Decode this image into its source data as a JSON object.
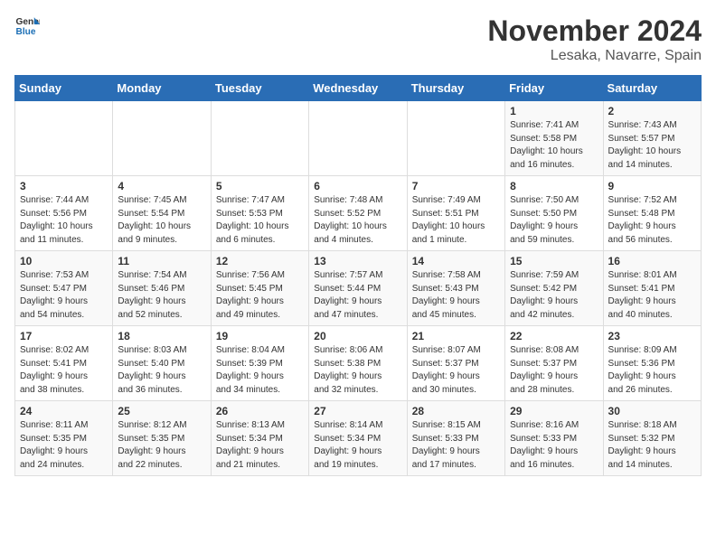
{
  "header": {
    "logo_line1": "General",
    "logo_line2": "Blue",
    "month_title": "November 2024",
    "location": "Lesaka, Navarre, Spain"
  },
  "weekdays": [
    "Sunday",
    "Monday",
    "Tuesday",
    "Wednesday",
    "Thursday",
    "Friday",
    "Saturday"
  ],
  "weeks": [
    [
      {
        "day": "",
        "info": ""
      },
      {
        "day": "",
        "info": ""
      },
      {
        "day": "",
        "info": ""
      },
      {
        "day": "",
        "info": ""
      },
      {
        "day": "",
        "info": ""
      },
      {
        "day": "1",
        "info": "Sunrise: 7:41 AM\nSunset: 5:58 PM\nDaylight: 10 hours\nand 16 minutes."
      },
      {
        "day": "2",
        "info": "Sunrise: 7:43 AM\nSunset: 5:57 PM\nDaylight: 10 hours\nand 14 minutes."
      }
    ],
    [
      {
        "day": "3",
        "info": "Sunrise: 7:44 AM\nSunset: 5:56 PM\nDaylight: 10 hours\nand 11 minutes."
      },
      {
        "day": "4",
        "info": "Sunrise: 7:45 AM\nSunset: 5:54 PM\nDaylight: 10 hours\nand 9 minutes."
      },
      {
        "day": "5",
        "info": "Sunrise: 7:47 AM\nSunset: 5:53 PM\nDaylight: 10 hours\nand 6 minutes."
      },
      {
        "day": "6",
        "info": "Sunrise: 7:48 AM\nSunset: 5:52 PM\nDaylight: 10 hours\nand 4 minutes."
      },
      {
        "day": "7",
        "info": "Sunrise: 7:49 AM\nSunset: 5:51 PM\nDaylight: 10 hours\nand 1 minute."
      },
      {
        "day": "8",
        "info": "Sunrise: 7:50 AM\nSunset: 5:50 PM\nDaylight: 9 hours\nand 59 minutes."
      },
      {
        "day": "9",
        "info": "Sunrise: 7:52 AM\nSunset: 5:48 PM\nDaylight: 9 hours\nand 56 minutes."
      }
    ],
    [
      {
        "day": "10",
        "info": "Sunrise: 7:53 AM\nSunset: 5:47 PM\nDaylight: 9 hours\nand 54 minutes."
      },
      {
        "day": "11",
        "info": "Sunrise: 7:54 AM\nSunset: 5:46 PM\nDaylight: 9 hours\nand 52 minutes."
      },
      {
        "day": "12",
        "info": "Sunrise: 7:56 AM\nSunset: 5:45 PM\nDaylight: 9 hours\nand 49 minutes."
      },
      {
        "day": "13",
        "info": "Sunrise: 7:57 AM\nSunset: 5:44 PM\nDaylight: 9 hours\nand 47 minutes."
      },
      {
        "day": "14",
        "info": "Sunrise: 7:58 AM\nSunset: 5:43 PM\nDaylight: 9 hours\nand 45 minutes."
      },
      {
        "day": "15",
        "info": "Sunrise: 7:59 AM\nSunset: 5:42 PM\nDaylight: 9 hours\nand 42 minutes."
      },
      {
        "day": "16",
        "info": "Sunrise: 8:01 AM\nSunset: 5:41 PM\nDaylight: 9 hours\nand 40 minutes."
      }
    ],
    [
      {
        "day": "17",
        "info": "Sunrise: 8:02 AM\nSunset: 5:41 PM\nDaylight: 9 hours\nand 38 minutes."
      },
      {
        "day": "18",
        "info": "Sunrise: 8:03 AM\nSunset: 5:40 PM\nDaylight: 9 hours\nand 36 minutes."
      },
      {
        "day": "19",
        "info": "Sunrise: 8:04 AM\nSunset: 5:39 PM\nDaylight: 9 hours\nand 34 minutes."
      },
      {
        "day": "20",
        "info": "Sunrise: 8:06 AM\nSunset: 5:38 PM\nDaylight: 9 hours\nand 32 minutes."
      },
      {
        "day": "21",
        "info": "Sunrise: 8:07 AM\nSunset: 5:37 PM\nDaylight: 9 hours\nand 30 minutes."
      },
      {
        "day": "22",
        "info": "Sunrise: 8:08 AM\nSunset: 5:37 PM\nDaylight: 9 hours\nand 28 minutes."
      },
      {
        "day": "23",
        "info": "Sunrise: 8:09 AM\nSunset: 5:36 PM\nDaylight: 9 hours\nand 26 minutes."
      }
    ],
    [
      {
        "day": "24",
        "info": "Sunrise: 8:11 AM\nSunset: 5:35 PM\nDaylight: 9 hours\nand 24 minutes."
      },
      {
        "day": "25",
        "info": "Sunrise: 8:12 AM\nSunset: 5:35 PM\nDaylight: 9 hours\nand 22 minutes."
      },
      {
        "day": "26",
        "info": "Sunrise: 8:13 AM\nSunset: 5:34 PM\nDaylight: 9 hours\nand 21 minutes."
      },
      {
        "day": "27",
        "info": "Sunrise: 8:14 AM\nSunset: 5:34 PM\nDaylight: 9 hours\nand 19 minutes."
      },
      {
        "day": "28",
        "info": "Sunrise: 8:15 AM\nSunset: 5:33 PM\nDaylight: 9 hours\nand 17 minutes."
      },
      {
        "day": "29",
        "info": "Sunrise: 8:16 AM\nSunset: 5:33 PM\nDaylight: 9 hours\nand 16 minutes."
      },
      {
        "day": "30",
        "info": "Sunrise: 8:18 AM\nSunset: 5:32 PM\nDaylight: 9 hours\nand 14 minutes."
      }
    ]
  ]
}
